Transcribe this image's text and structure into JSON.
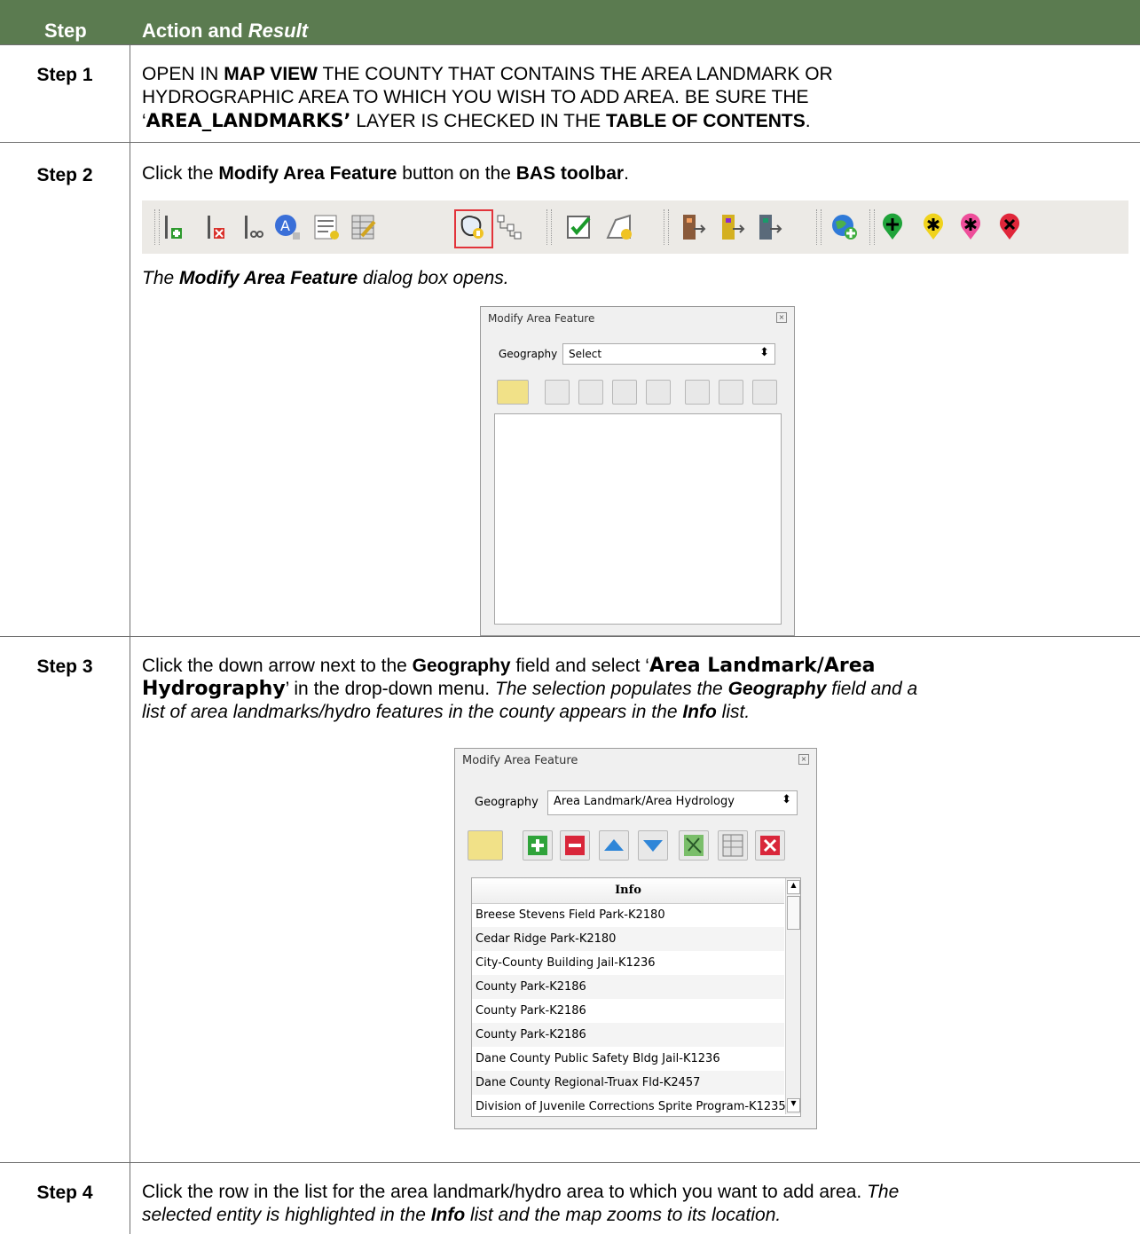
{
  "header": {
    "step_label": "Step",
    "action_label": "Action and ",
    "result_label": "Result"
  },
  "rows": [
    {
      "step": "Step 1",
      "line1_a": "OPEN IN ",
      "line1_b": "MAP VIEW",
      "line1_c": " THE COUNTY THAT CONTAINS THE AREA LANDMARK OR",
      "line2": "HYDROGRAPHIC AREA TO WHICH YOU WISH TO ADD AREA. BE SURE THE",
      "line3_a": "‘",
      "line3_b": "AREA_LANDMARKS’",
      "line3_c": " LAYER IS CHECKED IN THE ",
      "line3_d": "TABLE OF CONTENTS",
      "line3_e": "."
    },
    {
      "step": "Step 2",
      "a": "Click the ",
      "b": "Modify Area Feature",
      "c": " button on the ",
      "d": "BAS toolbar",
      "e": ".",
      "result_a": "The ",
      "result_b": "Modify Area Feature",
      "result_c": " dialog box opens."
    },
    {
      "step": "Step 3",
      "a": "Click the down arrow next to the ",
      "b": "Geography",
      "c": " field and select ‘",
      "d": "Area Landmark/Area",
      "e": "Hydrography",
      "f": "’ in the drop-down menu. ",
      "g": "The selection populates the ",
      "h": "Geography",
      "i": " field and a",
      "j": "list of area landmarks/hydro features in the county appears in the ",
      "k": "Info",
      "l": " list."
    },
    {
      "step": "Step 4",
      "a": "Click the row in the list for the area landmark/hydro area to which you want to add area. ",
      "b": "The",
      "c": "selected entity is highlighted in the ",
      "d": "Info",
      "e": " list and the map zooms to its location."
    }
  ],
  "toolbar": {
    "icons": [
      "add-line-icon",
      "delete-line-icon",
      "split-line-icon",
      "label-icon",
      "table-icon",
      "edit-table-icon",
      "modify-area-feature-icon",
      "hierarchy-icon",
      "validate-icon",
      "new-area-icon",
      "export-icon",
      "export-yellow-icon",
      "export-blue-icon",
      "globe-add-icon",
      "add-point-icon",
      "point-star-icon",
      "point-pink-icon",
      "delete-point-icon"
    ],
    "highlighted": "modify-area-feature-icon"
  },
  "dialog1": {
    "title": "Modify Area Feature",
    "geography_label": "Geography",
    "geography_value": "Select"
  },
  "dialog2": {
    "title": "Modify Area Feature",
    "geography_label": "Geography",
    "geography_value": "Area Landmark/Area Hydrology",
    "list_header": "Info",
    "items": [
      "Breese Stevens Field Park-K2180",
      "Cedar Ridge Park-K2180",
      "City-County Building Jail-K1236",
      "County Park-K2186",
      "County Park-K2186",
      "County Park-K2186",
      "Dane County Public Safety Bldg Jail-K1236",
      "Dane County Regional-Truax Fld-K2457",
      "Division of Juvenile Corrections Sprite Program-K1235"
    ]
  }
}
